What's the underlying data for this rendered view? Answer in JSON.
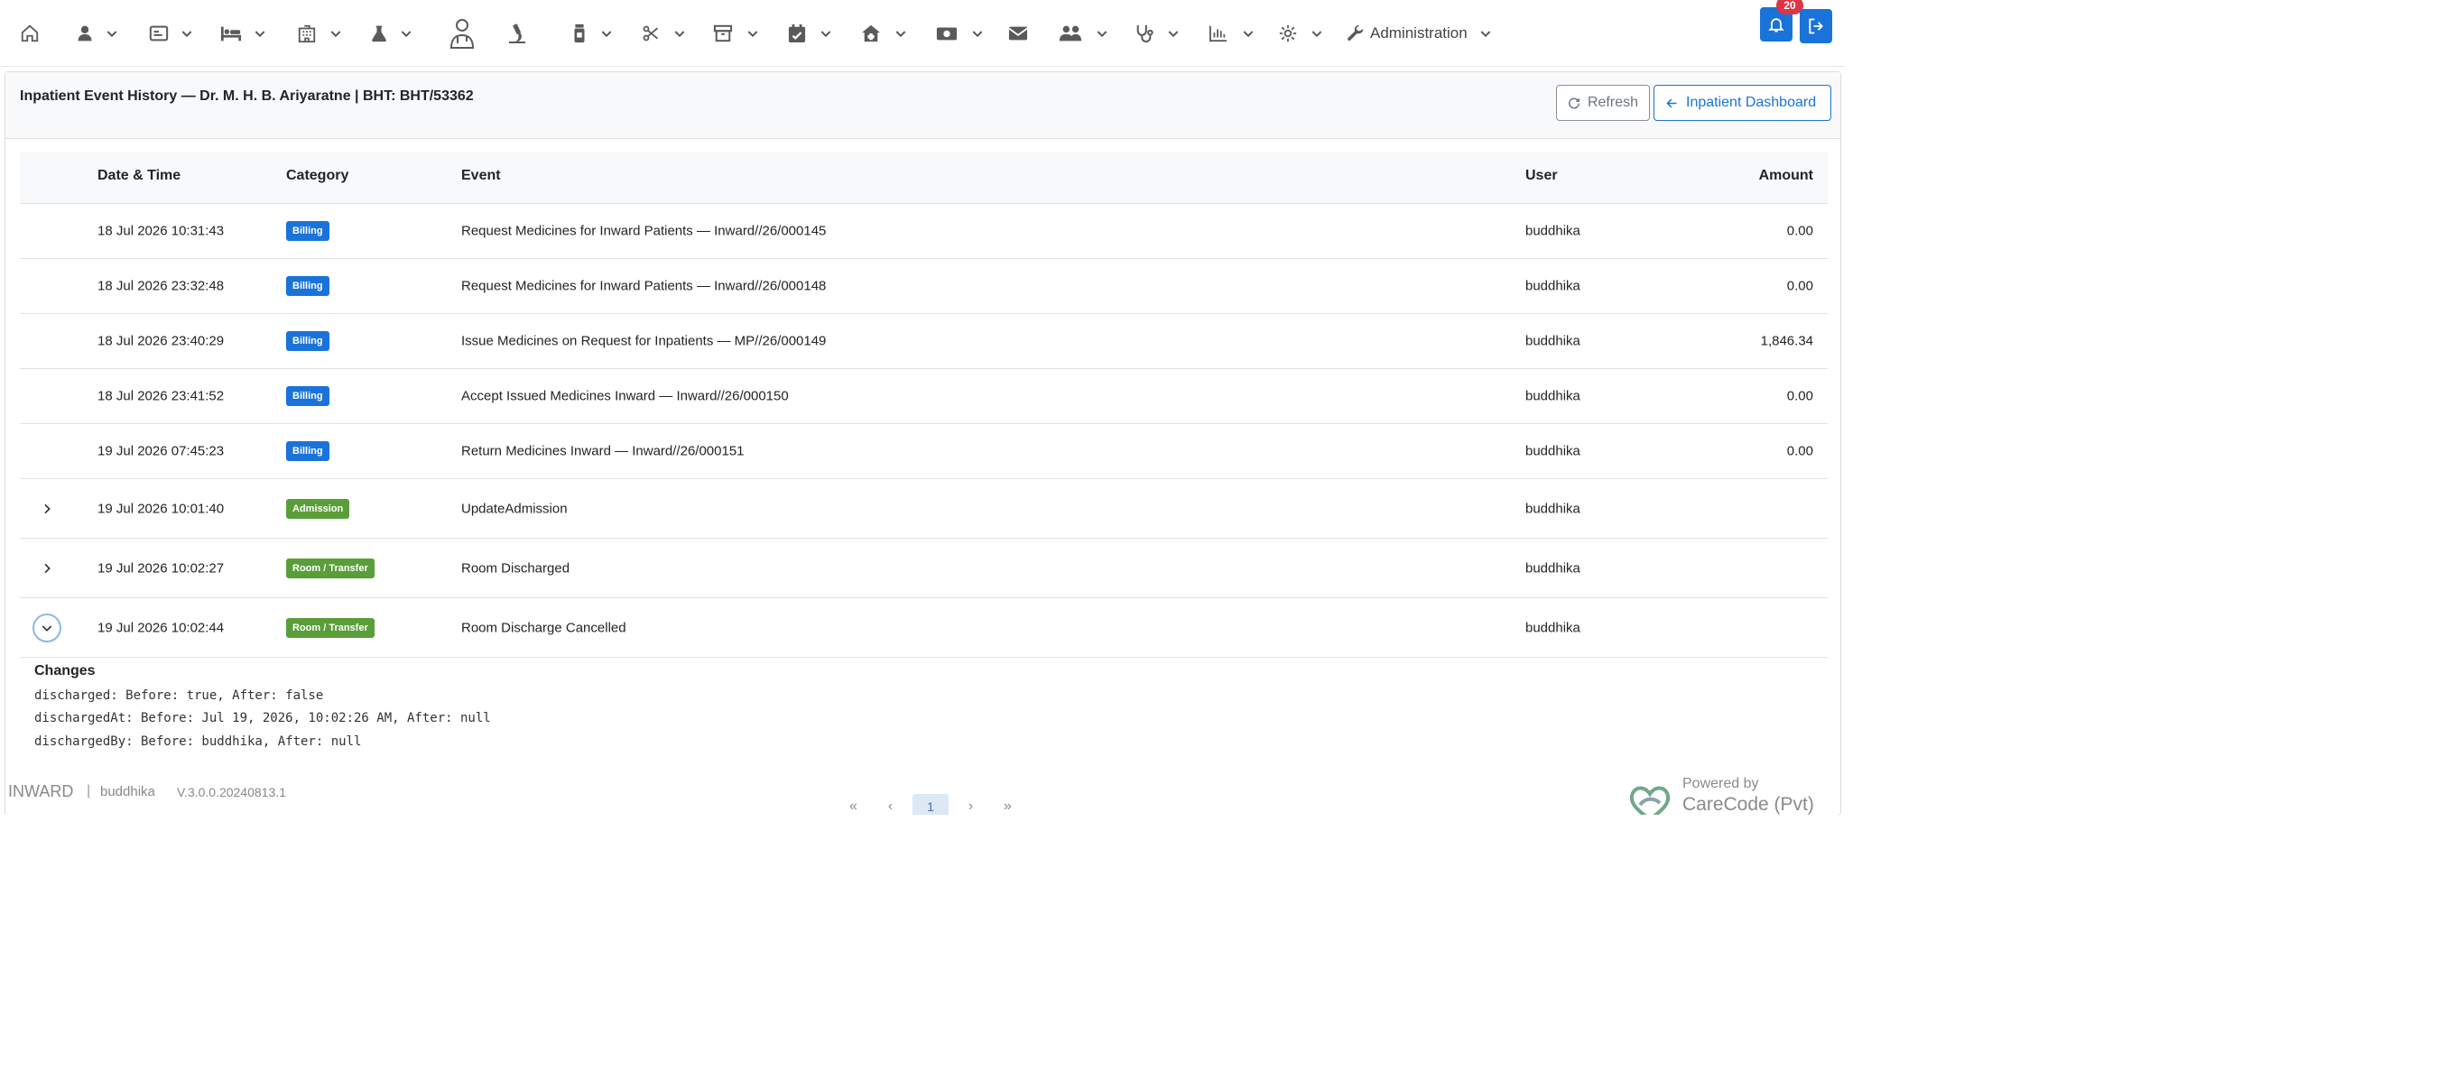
{
  "navbar": {
    "admin_label": "Administration",
    "notification_count": "20"
  },
  "header": {
    "title": "Inpatient Event History — Dr. M. H. B. Ariyaratne | BHT: BHT/53362",
    "refresh_label": "Refresh",
    "dashboard_label": "Inpatient Dashboard"
  },
  "table": {
    "columns": [
      "Date & Time",
      "Category",
      "Event",
      "User",
      "Amount"
    ],
    "rows": [
      {
        "datetime": "18 Jul 2026 10:31:43",
        "category": "Billing",
        "event": "Request Medicines for Inward Patients — Inward//26/000145",
        "user": "buddhika",
        "amount": "0.00"
      },
      {
        "datetime": "18 Jul 2026 23:32:48",
        "category": "Billing",
        "event": "Request Medicines for Inward Patients — Inward//26/000148",
        "user": "buddhika",
        "amount": "0.00"
      },
      {
        "datetime": "18 Jul 2026 23:40:29",
        "category": "Billing",
        "event": "Issue Medicines on Request for Inpatients — MP//26/000149",
        "user": "buddhika",
        "amount": "1,846.34"
      },
      {
        "datetime": "18 Jul 2026 23:41:52",
        "category": "Billing",
        "event": "Accept Issued Medicines Inward — Inward//26/000150",
        "user": "buddhika",
        "amount": "0.00"
      },
      {
        "datetime": "19 Jul 2026 07:45:23",
        "category": "Billing",
        "event": "Return Medicines Inward — Inward//26/000151",
        "user": "buddhika",
        "amount": "0.00"
      },
      {
        "datetime": "19 Jul 2026 10:01:40",
        "category": "Admission",
        "event": "UpdateAdmission",
        "user": "buddhika",
        "amount": ""
      },
      {
        "datetime": "19 Jul 2026 10:02:27",
        "category": "Room / Transfer",
        "event": "Room Discharged",
        "user": "buddhika",
        "amount": ""
      },
      {
        "datetime": "19 Jul 2026 10:02:44",
        "category": "Room / Transfer",
        "event": "Room Discharge Cancelled",
        "user": "buddhika",
        "amount": ""
      }
    ]
  },
  "changes": {
    "title": "Changes",
    "lines": [
      "discharged: Before: true, After: false",
      "dischargedAt: Before: Jul 19, 2026, 10:02:26 AM, After: null",
      "dischargedBy: Before: buddhika, After: null"
    ]
  },
  "footer": {
    "app_name": "INWARD",
    "separator": "|",
    "user": "buddhika",
    "version": "V.3.0.0.20240813.1",
    "powered_by": "Powered by",
    "company": "CareCode (Pvt) Ltd."
  },
  "pagination": {
    "first": "«",
    "prev": "‹",
    "current": "1",
    "next": "›",
    "last": "»"
  },
  "colors": {
    "primary": "#1a73d9",
    "billing_badge": "#1a73d9",
    "admission_badge": "#5a9e3a",
    "room_badge": "#5a9e3a",
    "danger": "#dc3545"
  },
  "icons": {
    "nav": [
      "home-icon",
      "user-icon",
      "id-card-icon",
      "bed-icon",
      "building-icon",
      "flask-icon",
      "doctor-icon",
      "microscope-icon",
      "bottle-icon",
      "scissors-icon",
      "store-icon",
      "calendar-icon",
      "clinic-icon",
      "money-icon",
      "mail-icon",
      "users-icon",
      "stethoscope-icon",
      "chart-icon",
      "gear-icon",
      "wrench-icon"
    ]
  }
}
